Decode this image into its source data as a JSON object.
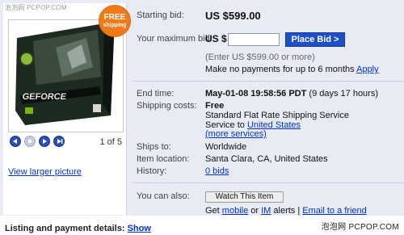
{
  "watermark": "泡泡网 PCPOP.COM",
  "watermark_bottom": "泡泡网 PCPOP.COM",
  "badge": {
    "free": "FREE",
    "shipping": "shipping"
  },
  "gallery": {
    "pager": "1 of 5",
    "view_larger": "View larger picture",
    "product_brand_text": "GEFORCE",
    "icons": [
      "prev-icon",
      "stop-icon",
      "play-icon",
      "next-icon"
    ]
  },
  "bid": {
    "starting_label": "Starting bid:",
    "starting_value": "US $599.00",
    "max_label": "Your maximum bid:",
    "currency": "US $",
    "input_value": "",
    "place_bid": "Place Bid >",
    "hint": "(Enter US $599.00 or more)",
    "payment_text": "Make no payments for up to 6 months",
    "apply": "Apply"
  },
  "details": {
    "end_label": "End time:",
    "end_value": "May-01-08 19:58:56 PDT",
    "end_remaining": "(9 days 17 hours)",
    "shipping_label": "Shipping costs:",
    "shipping_free": "Free",
    "shipping_service": "Standard Flat Rate Shipping Service",
    "shipping_to_prefix": "Service to",
    "shipping_to_link": "United States",
    "more_services": "(more services)",
    "ships_to_label": "Ships to:",
    "ships_to_value": "Worldwide",
    "location_label": "Item location:",
    "location_value": "Santa Clara, CA, United States",
    "history_label": "History:",
    "history_value": "0 bids"
  },
  "actions": {
    "label": "You can also:",
    "watch": "Watch This Item",
    "get": "Get",
    "mobile": "mobile",
    "or": "or",
    "im": "IM",
    "alerts": "alerts |",
    "email": "Email to a friend"
  },
  "footer": {
    "label": "Listing and payment details:",
    "show": "Show"
  },
  "colors": {
    "panel_bg": "#e8ebf4",
    "accent_blue": "#1f4fc6",
    "link_blue": "#0033cc",
    "badge_orange": "#f07a17"
  }
}
